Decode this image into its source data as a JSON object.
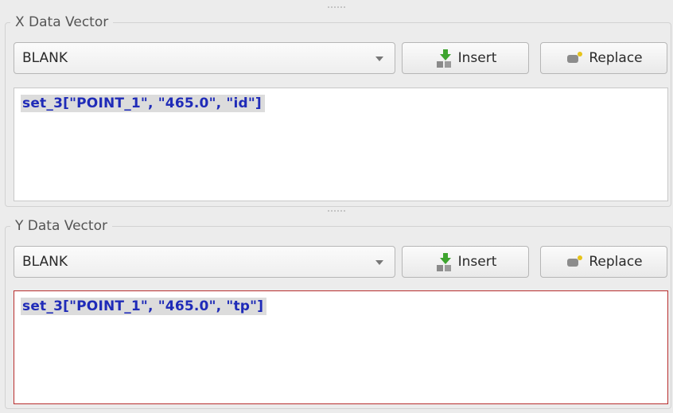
{
  "x_vector": {
    "title": "X Data Vector",
    "combo_value": "BLANK",
    "insert_label": "Insert",
    "replace_label": "Replace",
    "expression": "set_3[\"POINT_1\", \"465.0\", \"id\"]"
  },
  "y_vector": {
    "title": "Y Data Vector",
    "combo_value": "BLANK",
    "insert_label": "Insert",
    "replace_label": "Replace",
    "expression": "set_3[\"POINT_1\", \"465.0\", \"tp\"]"
  },
  "colors": {
    "expression_text": "#1f2bb8",
    "expression_highlight": "#dcdcdc",
    "error_border": "#b82e2e"
  },
  "icons": {
    "insert": "insert-icon",
    "replace": "replace-icon",
    "dropdown": "chevron-down-icon"
  }
}
